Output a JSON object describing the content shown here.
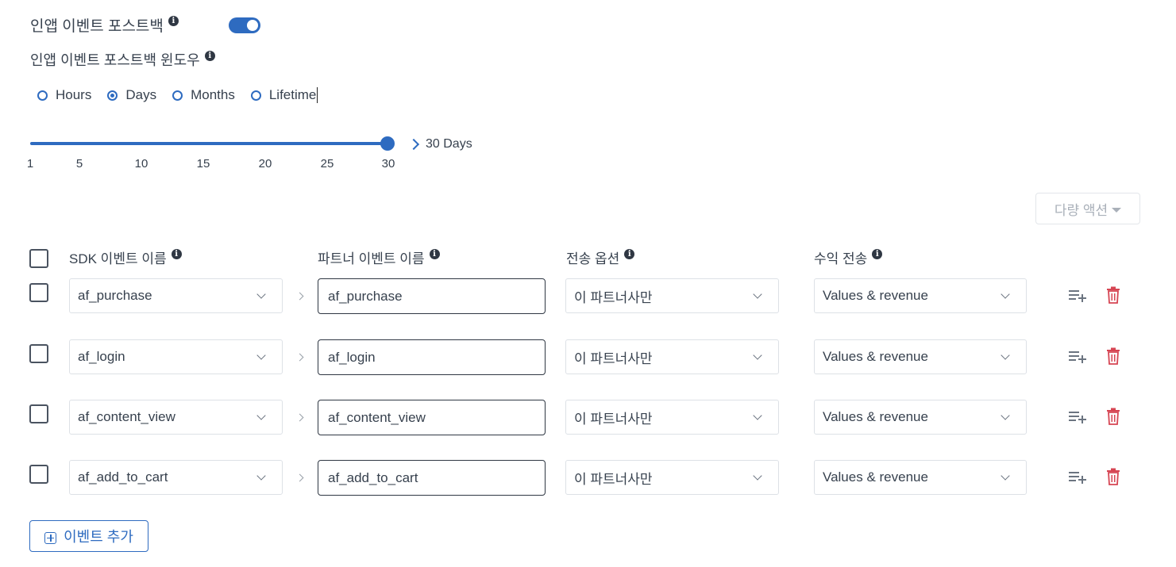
{
  "header": {
    "postback_label": "인앱 이벤트 포스트백",
    "postback_enabled": true,
    "window_label": "인앱 이벤트 포스트백 윈도우"
  },
  "window_units": {
    "options": [
      "Hours",
      "Days",
      "Months",
      "Lifetime"
    ],
    "selected": "Days"
  },
  "slider": {
    "ticks": [
      "1",
      "5",
      "10",
      "15",
      "20",
      "25",
      "30"
    ],
    "value": 30,
    "value_label": "30 Days"
  },
  "bulk_actions": {
    "label": "다량 액션"
  },
  "table": {
    "headers": {
      "sdk_event": "SDK 이벤트 이름",
      "partner_event": "파트너 이벤트 이름",
      "send_option": "전송 옵션",
      "revenue": "수익 전송"
    },
    "rows": [
      {
        "sdk_event": "af_purchase",
        "partner_event": "af_purchase",
        "send_option": "이 파트너사만",
        "revenue": "Values & revenue"
      },
      {
        "sdk_event": "af_login",
        "partner_event": "af_login",
        "send_option": "이 파트너사만",
        "revenue": "Values & revenue"
      },
      {
        "sdk_event": "af_content_view",
        "partner_event": "af_content_view",
        "send_option": "이 파트너사만",
        "revenue": "Values & revenue"
      },
      {
        "sdk_event": "af_add_to_cart",
        "partner_event": "af_add_to_cart",
        "send_option": "이 파트너사만",
        "revenue": "Values & revenue"
      }
    ]
  },
  "add_event": {
    "label": "이벤트 추가"
  },
  "colors": {
    "accent": "#2e6bc0",
    "danger": "#d64553",
    "text": "#37414e"
  }
}
